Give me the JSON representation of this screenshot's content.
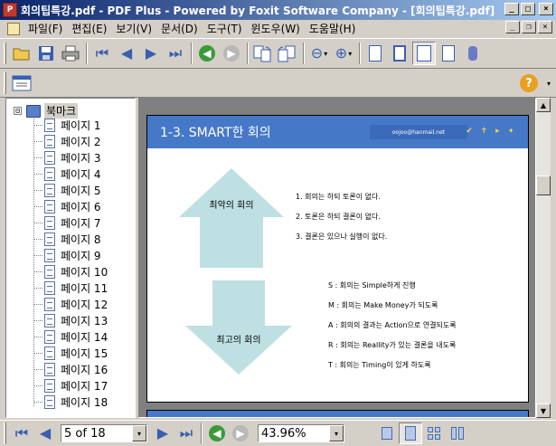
{
  "window": {
    "title": "회의팁특강.pdf - PDF Plus - Powered by Foxit Software Company  - [회의팁특강.pdf]",
    "app_icon_text": "P",
    "minimize_glyph": "_",
    "maximize_glyph": "□",
    "close_glyph": "×",
    "restore_glyph": "❐"
  },
  "menu": {
    "items": [
      "파일(F)",
      "편집(E)",
      "보기(V)",
      "문서(D)",
      "도구(T)",
      "윈도우(W)",
      "도움말(H)"
    ]
  },
  "toolbar": {
    "first_page_glyph": "⏮",
    "prev_page_glyph": "◀",
    "next_page_glyph": "▶",
    "last_page_glyph": "⏭",
    "back_glyph": "◀",
    "forward_glyph": "▶",
    "zoom_out_glyph": "⊖",
    "zoom_in_glyph": "⊕",
    "dropdown_glyph": "▾",
    "help_glyph": "?"
  },
  "sidebar": {
    "toggle": "⊟",
    "root_label": "북마크",
    "items": [
      "페이지 1",
      "페이지 2",
      "페이지 3",
      "페이지 4",
      "페이지 5",
      "페이지 6",
      "페이지 7",
      "페이지 8",
      "페이지 9",
      "페이지 10",
      "페이지 11",
      "페이지 12",
      "페이지 13",
      "페이지 14",
      "페이지 15",
      "페이지 16",
      "페이지 17",
      "페이지 18"
    ]
  },
  "document": {
    "title": "1-3. SMART한 회의",
    "email": "oojoo@hanmail.net",
    "header_icons": "✔ ✝ ▸ ➧",
    "worst_label": "최악의 회의",
    "best_label": "최고의 회의",
    "bad_points": [
      "1. 회의는 하되 토론이 없다.",
      "2. 토론은 하되 결론이 없다.",
      "3. 결론은 있으나 실행이 없다."
    ],
    "smart_points": [
      "S : 회의는 Simple하게 진행",
      "M : 회의는 Make Money가 되도록",
      "A : 회의의 결과는 Action으로 연결되도록",
      "R : 회의는 Reallity가 있는 결론을 내도록",
      "T : 회의는 Timing이 있게 하도록"
    ],
    "arrow_color": "#bfe0e3"
  },
  "scrollbar": {
    "up_glyph": "▲",
    "down_glyph": "▼"
  },
  "status": {
    "page_indicator": "5 of 18",
    "zoom_level": "43.96%",
    "dropdown_glyph": "▾"
  }
}
